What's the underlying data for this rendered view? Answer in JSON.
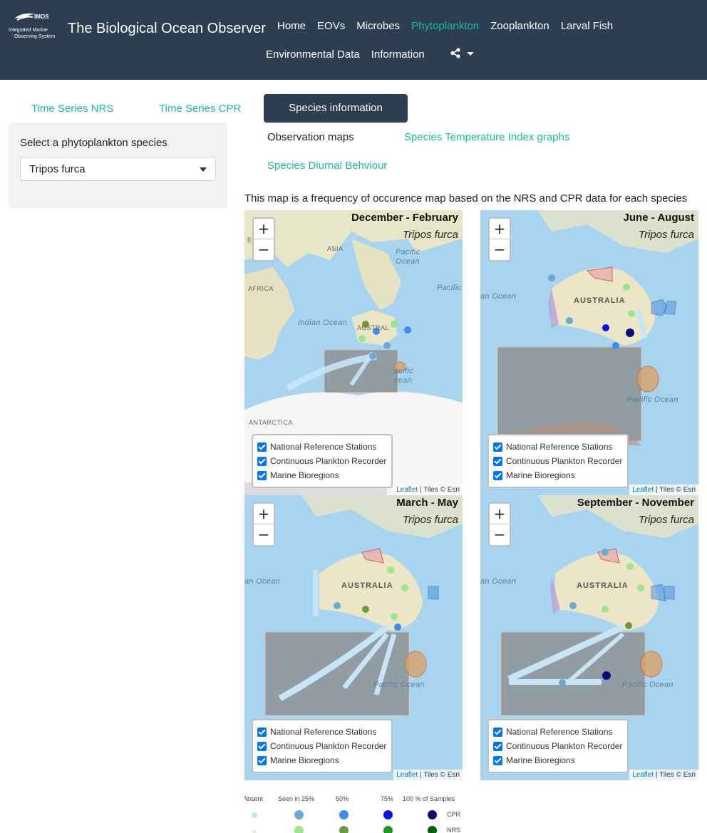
{
  "navbar": {
    "brand": "The Biological Ocean Observer",
    "logo_text_top": "IMOS",
    "logo_text_1": "Integrated Marine",
    "logo_text_2": "Observing System",
    "items_row1": [
      "Home",
      "EOVs",
      "Microbes",
      "Phytoplankton",
      "Zooplankton",
      "Larval Fish"
    ],
    "items_row2": [
      "Environmental Data",
      "Information"
    ],
    "active": "Phytoplankton",
    "share_icon": "share-icon"
  },
  "tabs": {
    "time_series_nrs": "Time Series NRS",
    "time_series_cpr": "Time Series CPR",
    "species_information": "Species information"
  },
  "subtabs": {
    "observation_maps": "Observation maps",
    "sti_graphs": "Species Temperature Index graphs",
    "diurnal": "Species Diurnal Behviour"
  },
  "sidebar": {
    "label": "Select a phytoplankton species",
    "selected": "Tripos furca"
  },
  "intro": "This map is a frequency of occurence map based on the NRS and CPR data for each species",
  "maps": [
    {
      "season": "December - February",
      "species": "Tripos furca"
    },
    {
      "season": "June - August",
      "species": "Tripos furca"
    },
    {
      "season": "March - May",
      "species": "Tripos furca"
    },
    {
      "season": "September - November",
      "species": "Tripos furca"
    }
  ],
  "layers": [
    "National Reference Stations",
    "Continuous Plankton Recorder",
    "Marine Bioregions"
  ],
  "zoom": {
    "in": "+",
    "out": "−"
  },
  "attribution": {
    "leaflet": "Leaflet",
    "tiles": " | Tiles © Esri"
  },
  "map_labels": {
    "asia": "ASIA",
    "africa": "AFRICA",
    "europe": "E",
    "antarctica": "ANTARCTICA",
    "australia": "AUSTRALIA",
    "austral": "AUSTRAL",
    "indian_ocean": "Indian Ocean",
    "ian_ocean": "an Ocean",
    "pacific_ocean": "Pacific Ocean",
    "pacific_a": "Pacific",
    "pacific_b": "Ocean",
    "pacific_c": "Pacific",
    "pacific_d": "acific",
    "pacific_e": "cean"
  },
  "legend": {
    "headers": [
      "Absent",
      "Seen in 25%",
      "50%",
      "75%",
      "100 % of Samples"
    ],
    "rows": [
      "CPR",
      "NRS"
    ],
    "cpr_colors": [
      "#bfe6f8",
      "#6aa9d8",
      "#3a8ee6",
      "#1010ee",
      "#0a0a7a"
    ],
    "nrs_colors": [
      "#d8f5d0",
      "#9ee68c",
      "#6e9a3c",
      "#1a9a1a",
      "#0b5e0b"
    ]
  },
  "colors": {
    "navbar_bg": "#2c3e50",
    "accent": "#18bc9c",
    "sidebar_bg": "#f2f2f2"
  }
}
